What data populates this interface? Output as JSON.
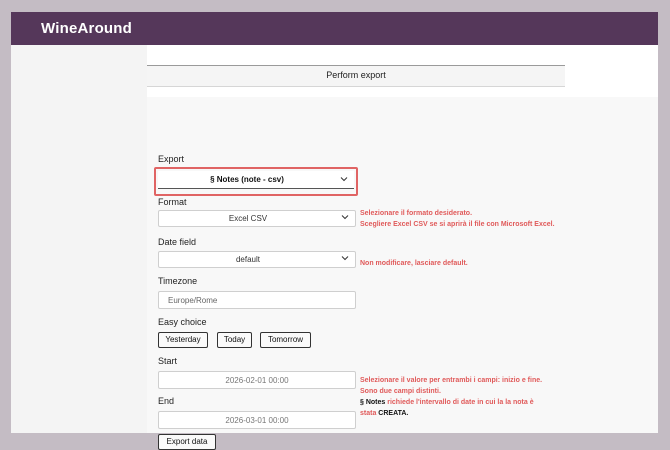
{
  "app": {
    "brand": "WineAround"
  },
  "page": {
    "title": "Perform export"
  },
  "form": {
    "export_label": "Export",
    "export_value": "§ Notes (note - csv)",
    "format_label": "Format",
    "format_value": "Excel CSV",
    "date_field_label": "Date field",
    "date_field_value": "default",
    "timezone_label": "Timezone",
    "timezone_value": "Europe/Rome",
    "easy_choice_label": "Easy choice",
    "easy_choice_buttons": [
      "Yesterday",
      "Today",
      "Tomorrow"
    ],
    "start_label": "Start",
    "start_value": "2026-02-01 00:00",
    "end_label": "End",
    "end_value": "2026-03-01 00:00",
    "export_button": "Export data"
  },
  "notes": {
    "format_1": "Selezionare il formato desiderato.",
    "format_2": "Scegliere Excel CSV se si aprirà il file con Microsoft Excel.",
    "date_field": "Non modificare, lasciare default.",
    "range_1": "Selezionare il valore per entrambi i campi: inizio e fine.",
    "range_2": "Sono due campi distinti.",
    "range_3_prefix": "§ Notes",
    "range_3_text": " richiede l'intervallo di date in cui la la nota è",
    "range_4_text": "stata ",
    "range_4_emph": "CREATA."
  },
  "colors": {
    "topbar": "#55375a",
    "annotation": "#e05a5a",
    "highlight": "#e06464"
  },
  "icons": {
    "dropdown": "chevron-down-icon"
  }
}
